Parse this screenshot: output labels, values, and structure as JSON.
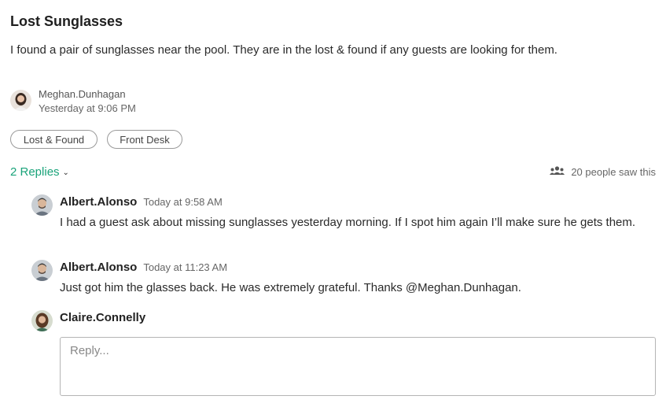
{
  "post": {
    "title": "Lost Sunglasses",
    "body": "I found a pair of sunglasses near the pool. They are in the lost & found if any guests are looking for them.",
    "author": "Meghan.Dunhagan",
    "timestamp": "Yesterday at 9:06 PM",
    "tags": [
      "Lost & Found",
      "Front Desk"
    ]
  },
  "thread": {
    "replies_label": "2 Replies",
    "views_label": "20 people saw this",
    "replies": [
      {
        "author": "Albert.Alonso",
        "time": "Today at 9:58 AM",
        "text": "I had a guest ask about missing sunglasses yesterday morning. If I spot him again I’ll make sure he gets them."
      },
      {
        "author": "Albert.Alonso",
        "time": "Today at 11:23 AM",
        "text": "Just got him the glasses back. He was extremely grateful. Thanks @Meghan.Dunhagan."
      }
    ]
  },
  "composer": {
    "user": "Claire.Connelly",
    "placeholder": "Reply..."
  },
  "colors": {
    "accent": "#1aa37a",
    "border": "#b5b5b5"
  }
}
